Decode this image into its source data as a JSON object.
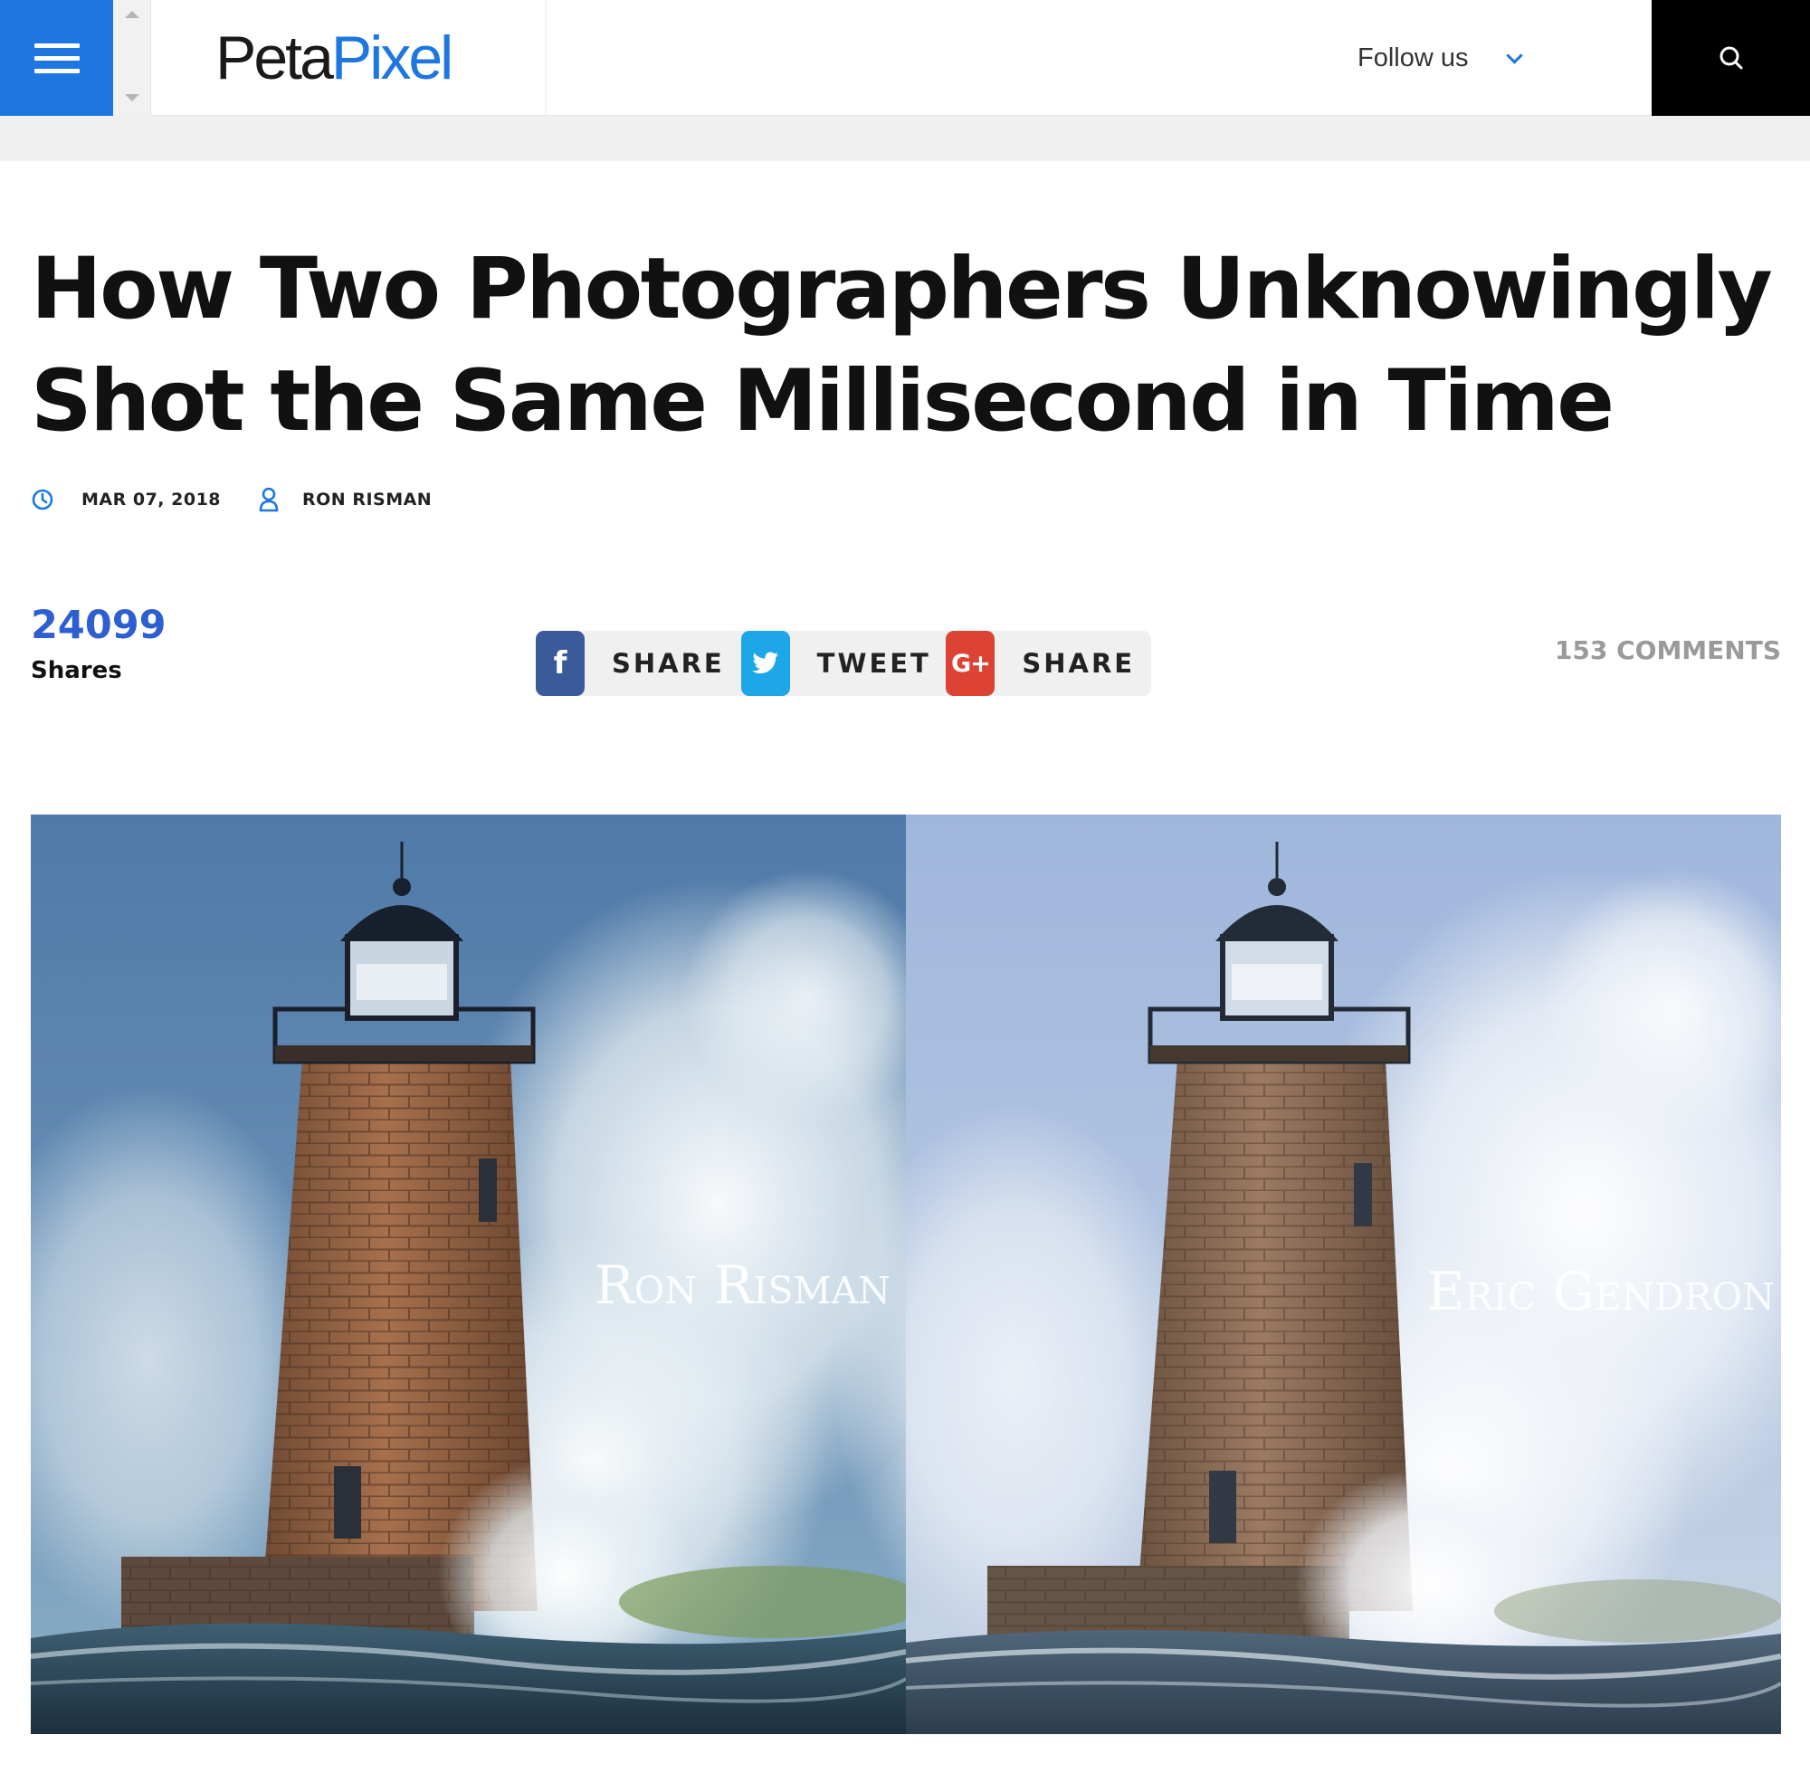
{
  "header": {
    "logo_part1": "Peta",
    "logo_part2": "Pixel",
    "follow_label": "Follow us"
  },
  "article": {
    "title": "How Two Photographers Unknowingly Shot the Same Millisecond in Time",
    "date": "MAR 07, 2018",
    "author": "RON RISMAN"
  },
  "social": {
    "share_count": "24099",
    "share_count_label": "Shares",
    "buttons": [
      {
        "icon": "f",
        "label": "SHARE"
      },
      {
        "icon": "twitter-bird",
        "label": "TWEET"
      },
      {
        "icon": "G+",
        "label": "SHARE"
      }
    ],
    "comments": "153 COMMENTS"
  },
  "hero": {
    "left_credit": "Ron Risman",
    "right_credit": "Eric Gendron"
  },
  "colors": {
    "brand_blue": "#1e77e0",
    "facebook": "#3b5a9a",
    "twitter": "#1da6e8",
    "google_plus": "#dc4335"
  }
}
